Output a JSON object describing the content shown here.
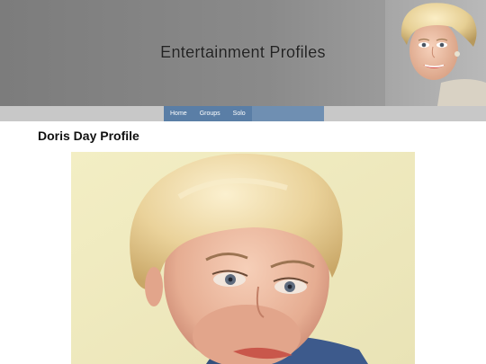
{
  "site": {
    "title": "Entertainment Profiles"
  },
  "nav": {
    "items": [
      {
        "label": "Home"
      },
      {
        "label": "Groups"
      },
      {
        "label": "Solo"
      }
    ]
  },
  "main": {
    "page_title": "Doris Day Profile"
  },
  "colors": {
    "header_bg": "#858585",
    "nav_bar_bg": "#c8c8c8",
    "nav_accent": "#6f8fb2"
  }
}
